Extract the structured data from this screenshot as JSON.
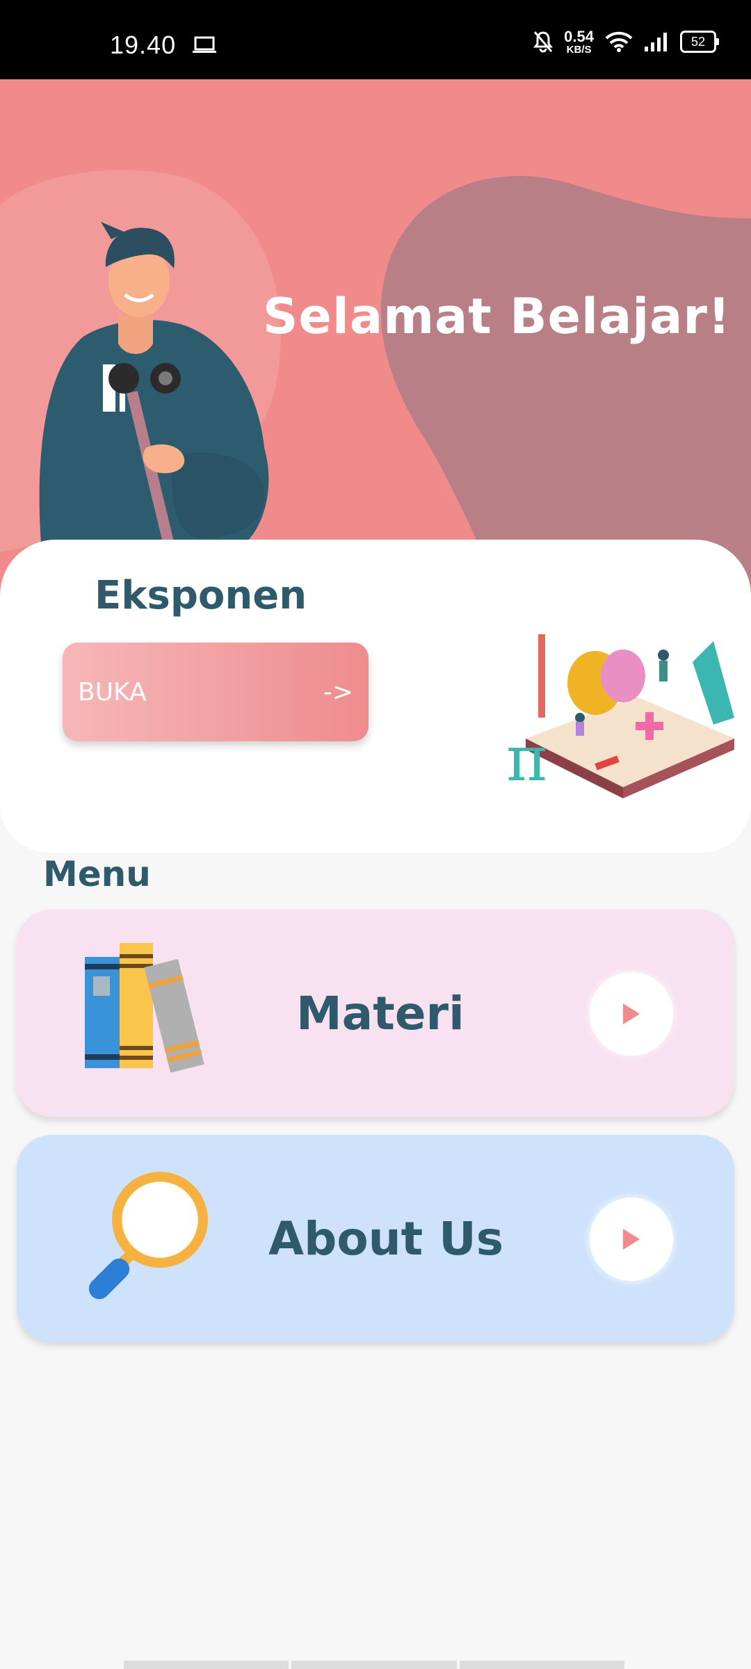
{
  "status_bar": {
    "time": "19.40",
    "net_speed_value": "0.54",
    "net_speed_unit": "KB/S",
    "battery": "52"
  },
  "hero": {
    "greeting": "Selamat Belajar!"
  },
  "featured": {
    "title": "Eksponen",
    "button_label": "BUKA",
    "button_arrow": "->"
  },
  "menu": {
    "label": "Menu",
    "items": [
      {
        "label": "Materi"
      },
      {
        "label": "About Us"
      }
    ]
  },
  "colors": {
    "hero_bg": "#f08a8b",
    "text_primary": "#2e5a6b",
    "materi_bg": "#f8e1f1",
    "about_bg": "#cfe2fb"
  }
}
